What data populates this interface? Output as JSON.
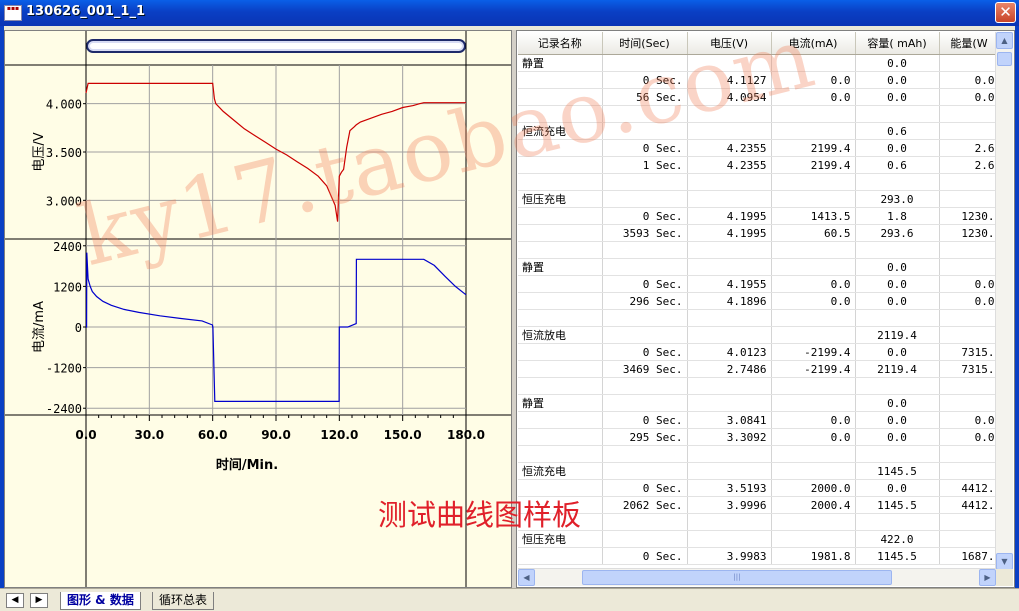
{
  "window": {
    "title": "130626_001_1_1",
    "close_label": "✕"
  },
  "chart_data": [
    {
      "type": "line",
      "title": "",
      "xlabel": "",
      "ylabel": "电压/V",
      "xlim": [
        0,
        180
      ],
      "ylim": [
        2.6,
        4.4
      ],
      "ytick_labels": [
        "4.000",
        "3.500",
        "3.000"
      ],
      "yticks": [
        4.0,
        3.5,
        3.0
      ],
      "grid": true,
      "series": [
        {
          "color": "#cc0000",
          "x": [
            0,
            1,
            60,
            60.8,
            61.5,
            65,
            70,
            75,
            80,
            85,
            90,
            95,
            100,
            105,
            110,
            114,
            116,
            118,
            119.2,
            120,
            121,
            122,
            123.5,
            125,
            127,
            128,
            130,
            135,
            140,
            145,
            150,
            155,
            158,
            160,
            165,
            170,
            175,
            180
          ],
          "y": [
            4.11,
            4.21,
            4.21,
            4.05,
            4.0,
            3.92,
            3.83,
            3.74,
            3.67,
            3.6,
            3.53,
            3.47,
            3.4,
            3.33,
            3.25,
            3.15,
            3.05,
            2.95,
            2.78,
            3.25,
            3.29,
            3.32,
            3.55,
            3.72,
            3.76,
            3.78,
            3.81,
            3.85,
            3.89,
            3.92,
            3.96,
            3.98,
            4.0,
            4.01,
            4.01,
            4.01,
            4.01,
            4.01
          ]
        }
      ]
    },
    {
      "type": "line",
      "title": "",
      "xlabel": "时间/Min.",
      "ylabel": "电流/mA",
      "xlim": [
        0,
        180
      ],
      "ylim": [
        -2600,
        2600
      ],
      "ytick_labels": [
        "2400",
        "1200",
        "0",
        "-1200",
        "-2400"
      ],
      "yticks": [
        2400,
        1200,
        0,
        -1200,
        -2400
      ],
      "xtick_labels": [
        "0.0",
        "30.0",
        "60.0",
        "90.0",
        "120.0",
        "150.0",
        "180.0"
      ],
      "xticks": [
        0,
        30,
        60,
        90,
        120,
        150,
        180
      ],
      "grid": true,
      "series": [
        {
          "color": "#0000cc",
          "x": [
            0,
            0.3,
            0.4,
            1,
            2,
            3,
            5,
            8,
            12,
            18,
            25,
            35,
            45,
            55,
            59.9,
            60,
            60.1,
            61,
            65,
            90,
            115,
            118,
            119.9,
            120,
            120.1,
            124,
            128,
            128.1,
            128.2,
            140,
            150,
            160,
            165,
            170,
            175,
            180
          ],
          "y": [
            0,
            0,
            2199,
            1414,
            1200,
            1050,
            900,
            760,
            640,
            520,
            430,
            330,
            250,
            180,
            60,
            0,
            0,
            -2199,
            -2199,
            -2199,
            -2199,
            -2199,
            -2199,
            0,
            0,
            0,
            100,
            2000,
            2000,
            2000,
            2000,
            2000,
            1820,
            1500,
            1200,
            950
          ]
        }
      ]
    }
  ],
  "table": {
    "headers": [
      "记录名称",
      "时间(Sec)",
      "电压(V)",
      "电流(mA)",
      "容量( mAh)",
      "能量(W"
    ],
    "rows": [
      [
        "静置",
        "",
        "",
        "",
        "0.0",
        ""
      ],
      [
        "",
        "0 Sec.",
        "4.1127",
        "0.0",
        "0.0",
        "0.0"
      ],
      [
        "",
        "56 Sec.",
        "4.0954",
        "0.0",
        "0.0",
        "0.0"
      ],
      [
        "",
        "",
        "",
        "",
        "",
        ""
      ],
      [
        "恒流充电",
        "",
        "",
        "",
        "0.6",
        ""
      ],
      [
        "",
        "0 Sec.",
        "4.2355",
        "2199.4",
        "0.0",
        "2.6"
      ],
      [
        "",
        "1 Sec.",
        "4.2355",
        "2199.4",
        "0.6",
        "2.6"
      ],
      [
        "",
        "",
        "",
        "",
        "",
        ""
      ],
      [
        "恒压充电",
        "",
        "",
        "",
        "293.0",
        ""
      ],
      [
        "",
        "0 Sec.",
        "4.1995",
        "1413.5",
        "1.8",
        "1230."
      ],
      [
        "",
        "3593 Sec.",
        "4.1995",
        "60.5",
        "293.6",
        "1230."
      ],
      [
        "",
        "",
        "",
        "",
        "",
        ""
      ],
      [
        "静置",
        "",
        "",
        "",
        "0.0",
        ""
      ],
      [
        "",
        "0 Sec.",
        "4.1955",
        "0.0",
        "0.0",
        "0.0"
      ],
      [
        "",
        "296 Sec.",
        "4.1896",
        "0.0",
        "0.0",
        "0.0"
      ],
      [
        "",
        "",
        "",
        "",
        "",
        ""
      ],
      [
        "恒流放电",
        "",
        "",
        "",
        "2119.4",
        ""
      ],
      [
        "",
        "0 Sec.",
        "4.0123",
        "-2199.4",
        "0.0",
        "7315."
      ],
      [
        "",
        "3469 Sec.",
        "2.7486",
        "-2199.4",
        "2119.4",
        "7315."
      ],
      [
        "",
        "",
        "",
        "",
        "",
        ""
      ],
      [
        "静置",
        "",
        "",
        "",
        "0.0",
        ""
      ],
      [
        "",
        "0 Sec.",
        "3.0841",
        "0.0",
        "0.0",
        "0.0"
      ],
      [
        "",
        "295 Sec.",
        "3.3092",
        "0.0",
        "0.0",
        "0.0"
      ],
      [
        "",
        "",
        "",
        "",
        "",
        ""
      ],
      [
        "恒流充电",
        "",
        "",
        "",
        "1145.5",
        ""
      ],
      [
        "",
        "0 Sec.",
        "3.5193",
        "2000.0",
        "0.0",
        "4412."
      ],
      [
        "",
        "2062 Sec.",
        "3.9996",
        "2000.4",
        "1145.5",
        "4412."
      ],
      [
        "",
        "",
        "",
        "",
        "",
        ""
      ],
      [
        "恒压充电",
        "",
        "",
        "",
        "422.0",
        ""
      ],
      [
        "",
        "0 Sec.",
        "3.9983",
        "1981.8",
        "1145.5",
        "1687."
      ]
    ]
  },
  "tabs": [
    {
      "label": "图形 & 数据",
      "active": true
    },
    {
      "label": "循环总表",
      "active": false
    }
  ],
  "nav": {
    "prev": "◀",
    "next": "▶"
  },
  "scroll": {
    "up": "▲",
    "down": "▼",
    "left": "◀",
    "right": "▶",
    "grip": "|||"
  },
  "watermarks": {
    "url": "ky17.taobao.com",
    "text": "测试曲线图样板"
  },
  "colors": {
    "title_bar": "#0a3fc4",
    "chart_bg": "#fffde6",
    "voltage_line": "#cc0000",
    "current_line": "#0000cc"
  }
}
